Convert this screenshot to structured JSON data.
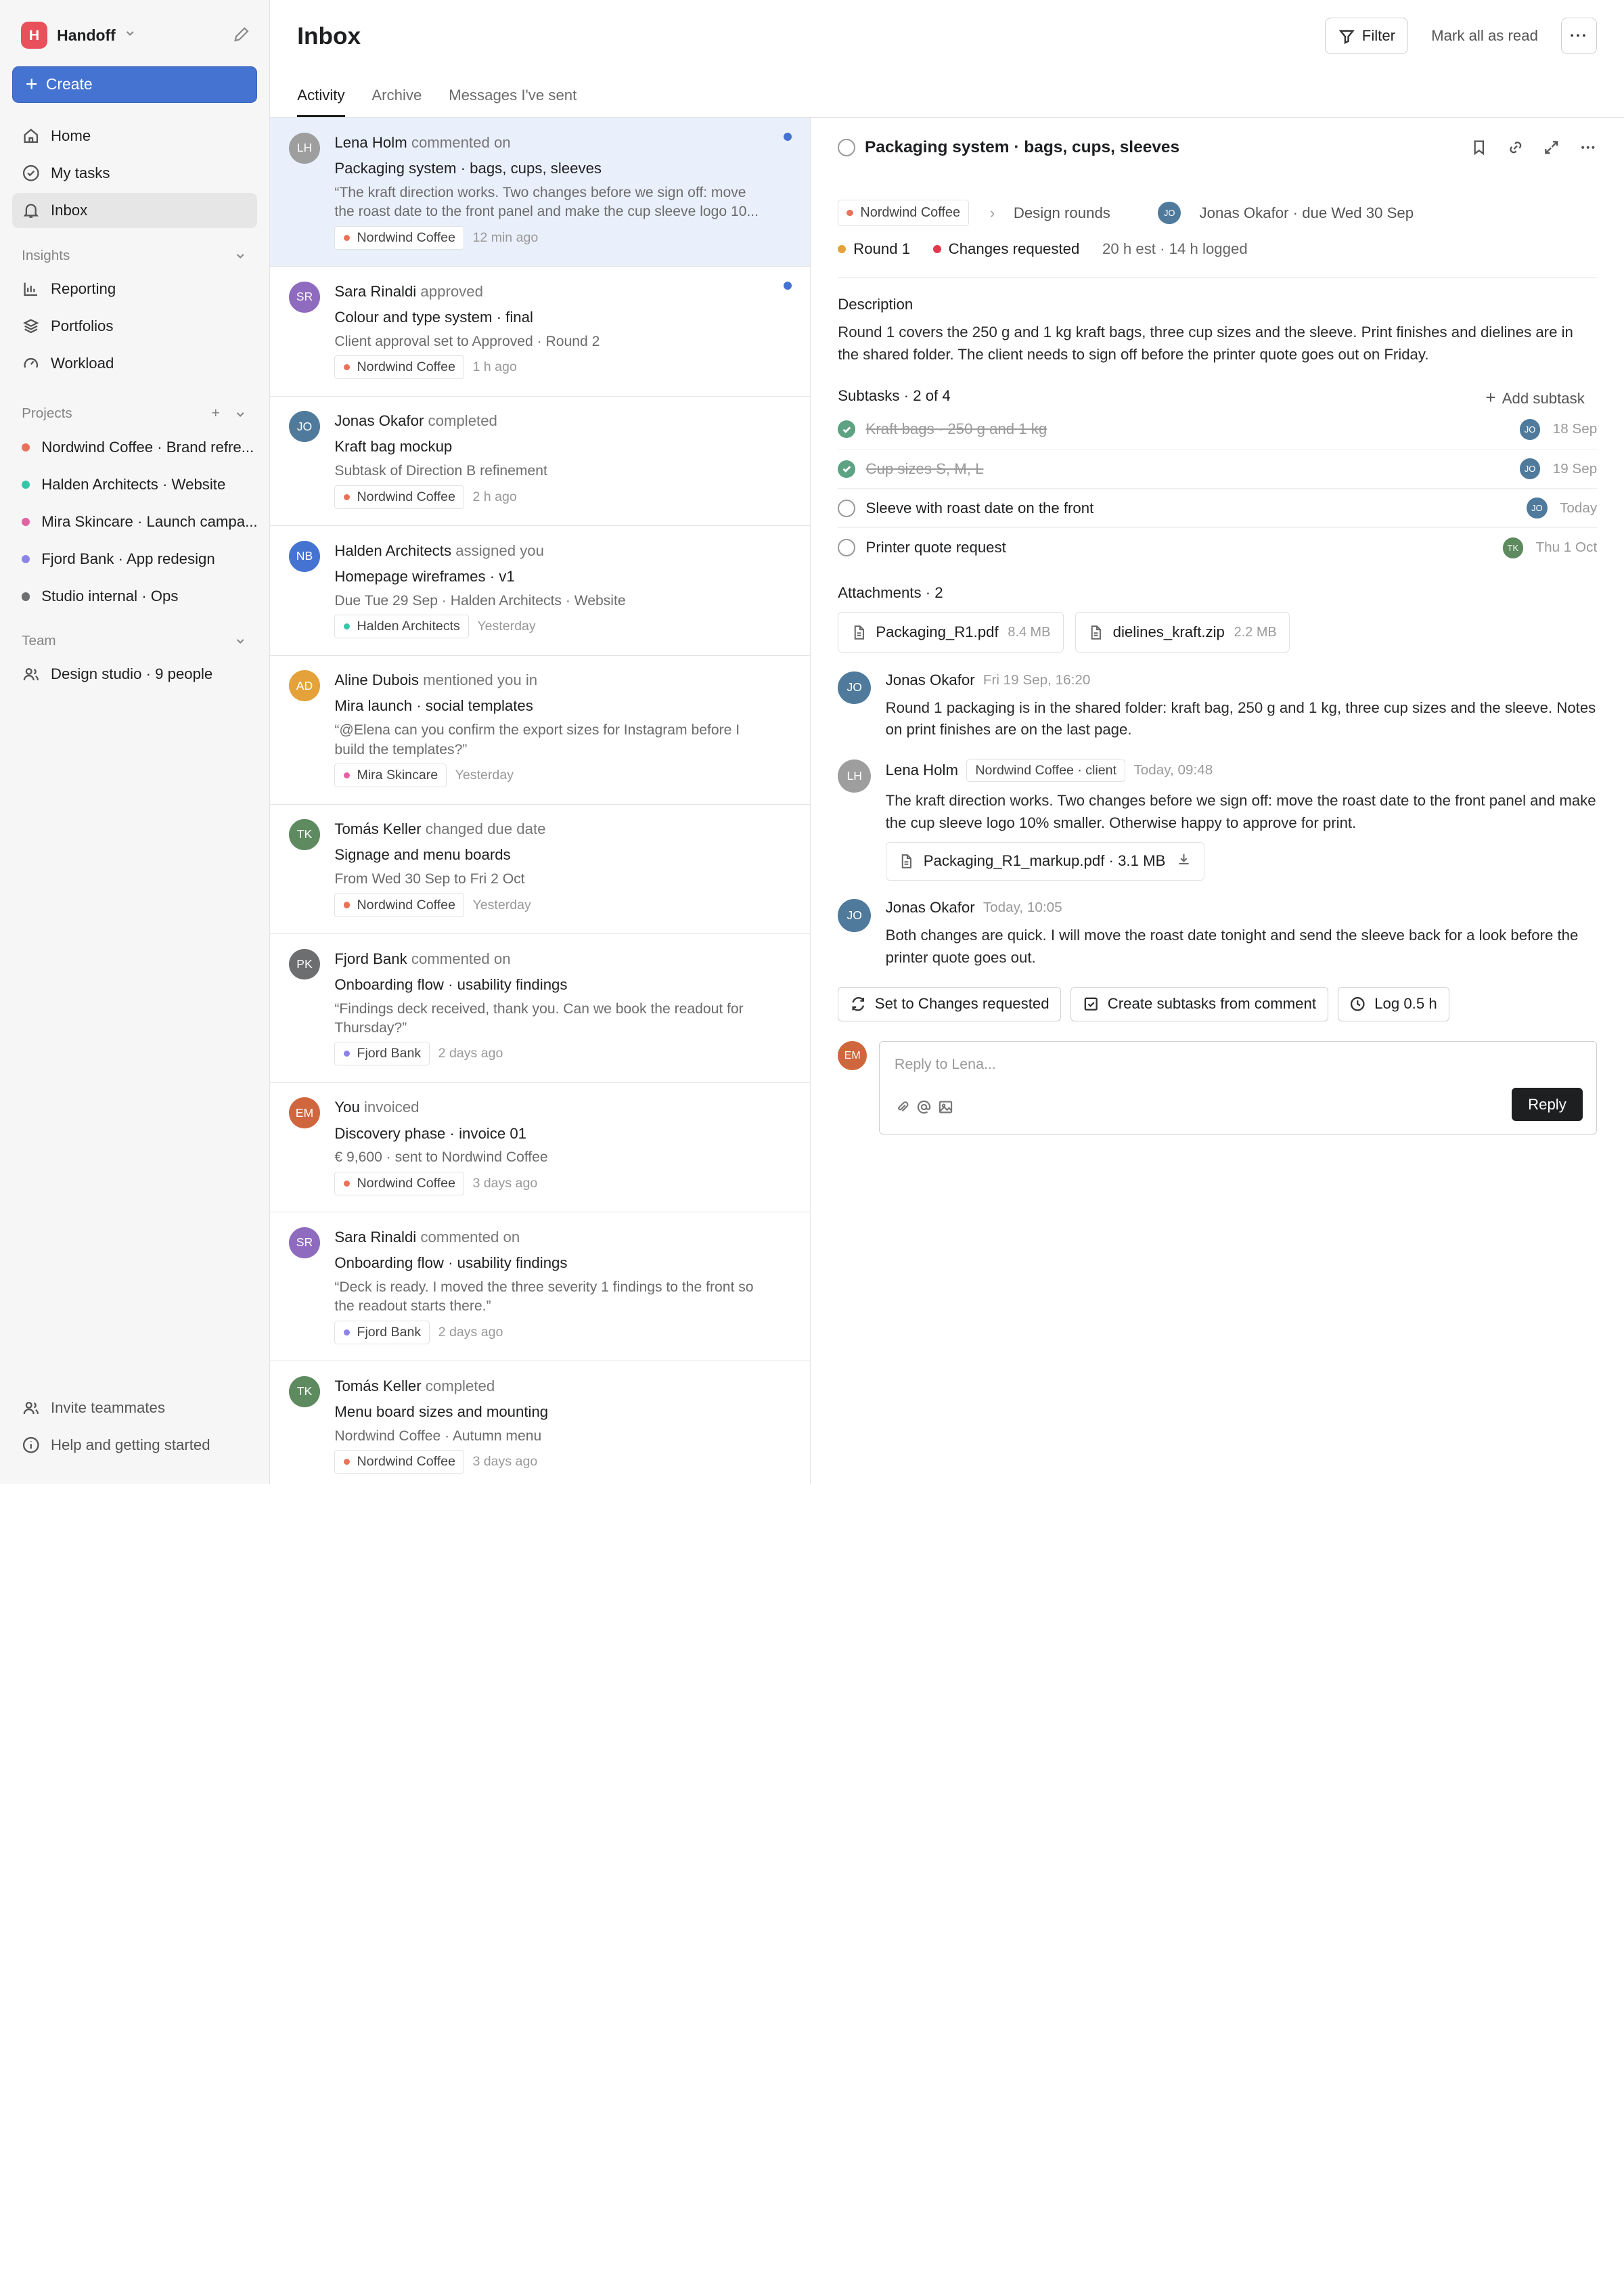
{
  "workspace": {
    "initial": "H",
    "name": "Handoff",
    "logo_color": "#e8505b"
  },
  "sidebar": {
    "create_label": "Create",
    "nav": [
      {
        "label": "Home",
        "icon": "home-icon"
      },
      {
        "label": "My tasks",
        "icon": "check-circle-icon"
      },
      {
        "label": "Inbox",
        "icon": "bell-icon",
        "active": true
      }
    ],
    "insights": {
      "title": "Insights",
      "items": [
        {
          "label": "Reporting",
          "icon": "chart-icon"
        },
        {
          "label": "Portfolios",
          "icon": "layers-icon"
        },
        {
          "label": "Workload",
          "icon": "gauge-icon"
        }
      ]
    },
    "projects": {
      "title": "Projects",
      "items": [
        {
          "label": "Nordwind Coffee · Brand refre...",
          "color": "#e8735a"
        },
        {
          "label": "Halden Architects · Website",
          "color": "#37c5ab"
        },
        {
          "label": "Mira Skincare · Launch campa...",
          "color": "#e362a3"
        },
        {
          "label": "Fjord Bank · App redesign",
          "color": "#8d84e8"
        },
        {
          "label": "Studio internal · Ops",
          "color": "#6d6e6f"
        }
      ]
    },
    "team": {
      "title": "Team",
      "item": "Design studio · 9 people"
    },
    "footer": {
      "invite": "Invite teammates",
      "help": "Help and getting started"
    }
  },
  "header": {
    "title": "Inbox",
    "filter_label": "Filter",
    "mark_all_label": "Mark all as read",
    "more_label": "···"
  },
  "tabs": [
    {
      "label": "Activity",
      "active": true
    },
    {
      "label": "Archive"
    },
    {
      "label": "Messages I've sent"
    }
  ],
  "feed": [
    {
      "initials": "LH",
      "color": "#9e9e9e",
      "who": "Lena Holm",
      "action": "commented on",
      "title": "Packaging system · bags, cups, sleeves",
      "sub": "“The kraft direction works. Two changes before we sign off: move the roast date to the front panel and make the cup sleeve logo 10...",
      "tag": "Nordwind Coffee",
      "tag_color": "#e8735a",
      "time": "12 min ago",
      "unread": true,
      "selected": true
    },
    {
      "initials": "SR",
      "color": "#8e6bbf",
      "who": "Sara Rinaldi",
      "action": "approved",
      "title": "Colour and type system · final",
      "sub": "Client approval set to Approved · Round 2",
      "tag": "Nordwind Coffee",
      "tag_color": "#e8735a",
      "time": "1 h ago",
      "unread": true
    },
    {
      "initials": "JO",
      "color": "#4f7a9c",
      "who": "Jonas Okafor",
      "action": "completed",
      "title": "Kraft bag mockup",
      "sub": "Subtask of Direction B refinement",
      "tag": "Nordwind Coffee",
      "tag_color": "#e8735a",
      "time": "2 h ago"
    },
    {
      "initials": "NB",
      "color": "#4573d2",
      "who": "Halden Architects",
      "action": "assigned you",
      "title": "Homepage wireframes · v1",
      "sub": "Due Tue 29 Sep · Halden Architects · Website",
      "tag": "Halden Architects",
      "tag_color": "#37c5ab",
      "time": "Yesterday"
    },
    {
      "initials": "AD",
      "color": "#e5a23a",
      "who": "Aline Dubois",
      "action": "mentioned you in",
      "title": "Mira launch · social templates",
      "sub": "“@Elena can you confirm the export sizes for Instagram before I build the templates?”",
      "tag": "Mira Skincare",
      "tag_color": "#e362a3",
      "time": "Yesterday"
    },
    {
      "initials": "TK",
      "color": "#5d8a5e",
      "who": "Tomás Keller",
      "action": "changed due date",
      "title": "Signage and menu boards",
      "sub": "From Wed 30 Sep to Fri 2 Oct",
      "tag": "Nordwind Coffee",
      "tag_color": "#e8735a",
      "time": "Yesterday"
    },
    {
      "initials": "PK",
      "color": "#6d6e6f",
      "who": "Fjord Bank",
      "action": "commented on",
      "title": "Onboarding flow · usability findings",
      "sub": "“Findings deck received, thank you. Can we book the readout for Thursday?”",
      "tag": "Fjord Bank",
      "tag_color": "#8d84e8",
      "time": "2 days ago"
    },
    {
      "initials": "EM",
      "color": "#d0663e",
      "who": "You",
      "action": "invoiced",
      "title": "Discovery phase · invoice 01",
      "sub": "€ 9,600 · sent to Nordwind Coffee",
      "tag": "Nordwind Coffee",
      "tag_color": "#e8735a",
      "time": "3 days ago"
    },
    {
      "initials": "SR",
      "color": "#8e6bbf",
      "who": "Sara Rinaldi",
      "action": "commented on",
      "title": "Onboarding flow · usability findings",
      "sub": "“Deck is ready. I moved the three severity 1 findings to the front so the readout starts there.”",
      "tag": "Fjord Bank",
      "tag_color": "#8d84e8",
      "time": "2 days ago"
    },
    {
      "initials": "TK",
      "color": "#5d8a5e",
      "who": "Tomás Keller",
      "action": "completed",
      "title": "Menu board sizes and mounting",
      "sub": "Nordwind Coffee · Autumn menu",
      "tag": "Nordwind Coffee",
      "tag_color": "#e8735a",
      "time": "3 days ago"
    }
  ],
  "detail": {
    "title": "Packaging system · bags, cups, sleeves",
    "project_tag": "Nordwind Coffee",
    "section": "Design rounds",
    "assignee_initials": "JO",
    "assignee_due": "Jonas Okafor · due Wed 30 Sep",
    "round": "Round 1",
    "round_color": "#e5a23a",
    "status": "Changes requested",
    "status_color": "#e0394d",
    "estimate": "20 h est · 14 h logged",
    "description_label": "Description",
    "description": "Round 1 covers the 250 g and 1 kg kraft bags, three cup sizes and the sleeve. Print finishes and dielines are in the shared folder. The client needs to sign off before the printer quote goes out on Friday.",
    "subtasks_label": "Subtasks · 2 of 4",
    "add_subtask": "Add subtask",
    "subtasks": [
      {
        "label": "Kraft bags · 250 g and 1 kg",
        "done": true,
        "initials": "JO",
        "av_color": "#4f7a9c",
        "due": "18 Sep"
      },
      {
        "label": "Cup sizes S, M, L",
        "done": true,
        "initials": "JO",
        "av_color": "#4f7a9c",
        "due": "19 Sep"
      },
      {
        "label": "Sleeve with roast date on the front",
        "done": false,
        "initials": "JO",
        "av_color": "#4f7a9c",
        "due": "Today"
      },
      {
        "label": "Printer quote request",
        "done": false,
        "initials": "TK",
        "av_color": "#5d8a5e",
        "due": "Thu 1 Oct"
      }
    ],
    "attachments_label": "Attachments · 2",
    "attachments": [
      {
        "name": "Packaging_R1.pdf",
        "size": "8.4 MB"
      },
      {
        "name": "dielines_kraft.zip",
        "size": "2.2 MB"
      }
    ],
    "comments": [
      {
        "initials": "JO",
        "color": "#4f7a9c",
        "name": "Jonas Okafor",
        "when": "Fri 19 Sep, 16:20",
        "body": "Round 1 packaging is in the shared folder: kraft bag, 250 g and 1 kg, three cup sizes and the sleeve. Notes on print finishes are on the last page."
      },
      {
        "initials": "LH",
        "color": "#9e9e9e",
        "name": "Lena Holm",
        "badge": "Nordwind Coffee · client",
        "when": "Today, 09:48",
        "body": "The kraft direction works. Two changes before we sign off: move the roast date to the front panel and make the cup sleeve logo 10% smaller. Otherwise happy to approve for print.",
        "attachment": "Packaging_R1_markup.pdf · 3.1 MB"
      },
      {
        "initials": "JO",
        "color": "#4f7a9c",
        "name": "Jonas Okafor",
        "when": "Today, 10:05",
        "body": "Both changes are quick. I will move the roast date tonight and send the sleeve back for a look before the printer quote goes out."
      }
    ],
    "actions": [
      {
        "label": "Set to Changes requested",
        "icon": "refresh-icon"
      },
      {
        "label": "Create subtasks from comment",
        "icon": "checkbox-icon"
      },
      {
        "label": "Log 0.5 h",
        "icon": "clock-icon"
      }
    ],
    "reply": {
      "initials": "EM",
      "color": "#d0663e",
      "placeholder": "Reply to Lena...",
      "button": "Reply"
    }
  }
}
